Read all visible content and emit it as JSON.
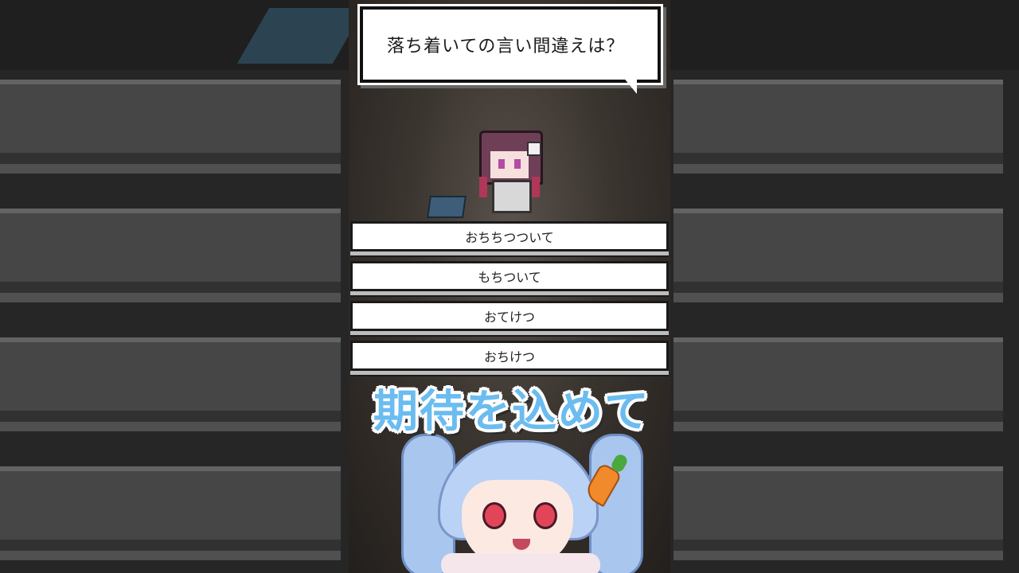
{
  "game": {
    "question": "落ち着いての言い間違えは？",
    "choices": [
      {
        "label": "おちちつついて"
      },
      {
        "label": "もちついて"
      },
      {
        "label": "おてけつ"
      },
      {
        "label": "おちけつ"
      }
    ]
  },
  "caption": {
    "text": "期待を込めて",
    "color": "#6bbcf0"
  },
  "icons": {
    "pixel_character": "pixel-girl-sprite",
    "avatar": "vtuber-avatar",
    "carrot": "carrot-icon"
  }
}
